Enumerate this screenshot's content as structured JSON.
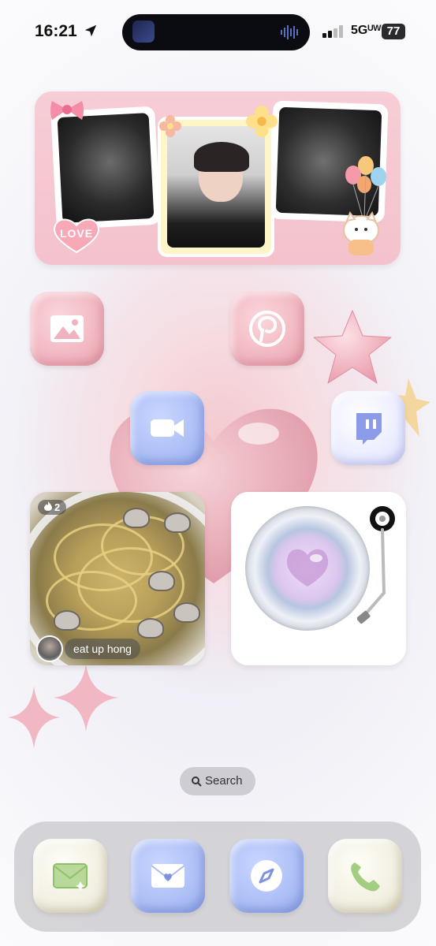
{
  "status_bar": {
    "time": "16:21",
    "network": "5Gᵁᵂ",
    "battery": "77",
    "icons": [
      "location-arrow-icon",
      "audio-wave-icon",
      "signal-bars-icon"
    ]
  },
  "photo_widget": {
    "sticker_text": "LOVE",
    "icons": [
      "bow-icon",
      "cat-balloon-icon",
      "flower-icon",
      "heart-icon"
    ]
  },
  "apps": {
    "photos": {
      "icon": "photos-icon",
      "color": "#f0b3bd"
    },
    "pinterest": {
      "icon": "pinterest-icon",
      "color": "#f0b3bd"
    },
    "facetime": {
      "icon": "video-camera-icon",
      "color": "#a8bbf4"
    },
    "twitch": {
      "icon": "twitch-icon",
      "color": "#e8eaff"
    }
  },
  "food_widget": {
    "fire_count": "2",
    "caption": "eat up hong"
  },
  "record_widget": {
    "icon": "vinyl-record-icon"
  },
  "search": {
    "label": "Search"
  },
  "dock": {
    "apps": [
      {
        "icon": "messages-icon",
        "color": "#f0ede0"
      },
      {
        "icon": "mail-icon",
        "color": "#a8bbf4"
      },
      {
        "icon": "safari-compass-icon",
        "color": "#a8bbf4"
      },
      {
        "icon": "phone-icon",
        "color": "#f0ede0"
      }
    ]
  }
}
